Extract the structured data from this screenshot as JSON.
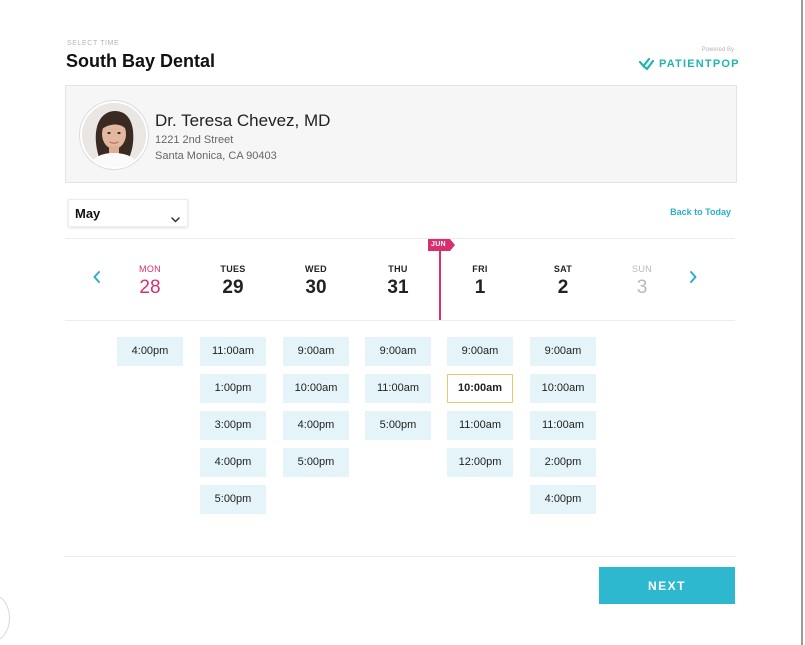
{
  "header": {
    "kicker": "SELECT TIME",
    "title": "South Bay Dental",
    "powered_by": "Powered By",
    "brand": "PATIENTPOP"
  },
  "provider": {
    "name": "Dr. Teresa Chevez, MD",
    "address_line1": "1221 2nd Street",
    "address_line2": "Santa Monica, CA 90403"
  },
  "month_select": {
    "value": "May"
  },
  "back_to_today": "Back to Today",
  "month_marker": "JUN",
  "days": [
    {
      "dow": "MON",
      "date": "28",
      "state": "today",
      "slots": [
        "4:00pm"
      ]
    },
    {
      "dow": "TUES",
      "date": "29",
      "state": "normal",
      "slots": [
        "11:00am",
        "1:00pm",
        "3:00pm",
        "4:00pm",
        "5:00pm"
      ]
    },
    {
      "dow": "WED",
      "date": "30",
      "state": "normal",
      "slots": [
        "9:00am",
        "10:00am",
        "4:00pm",
        "5:00pm"
      ]
    },
    {
      "dow": "THU",
      "date": "31",
      "state": "normal",
      "slots": [
        "9:00am",
        "11:00am",
        "5:00pm"
      ]
    },
    {
      "dow": "FRI",
      "date": "1",
      "state": "normal",
      "slots": [
        "9:00am",
        "10:00am",
        "11:00am",
        "12:00pm"
      ]
    },
    {
      "dow": "SAT",
      "date": "2",
      "state": "normal",
      "slots": [
        "9:00am",
        "10:00am",
        "11:00am",
        "2:00pm",
        "4:00pm"
      ]
    },
    {
      "dow": "SUN",
      "date": "3",
      "state": "disabled",
      "slots": []
    }
  ],
  "selected_slot": {
    "day": "FRI",
    "time": "10:00am"
  },
  "actions": {
    "next": "NEXT"
  },
  "colors": {
    "accent_teal": "#2db8cf",
    "today_pink": "#d6306e",
    "slot_bg": "#e4f4f8",
    "selected_border": "#e8c869",
    "brand_green": "#22b5b0"
  },
  "icons": {
    "prev": "chevron-left-icon",
    "next": "chevron-right-icon",
    "dropdown": "chevron-down-icon",
    "brand": "patientpop-logo-icon"
  }
}
